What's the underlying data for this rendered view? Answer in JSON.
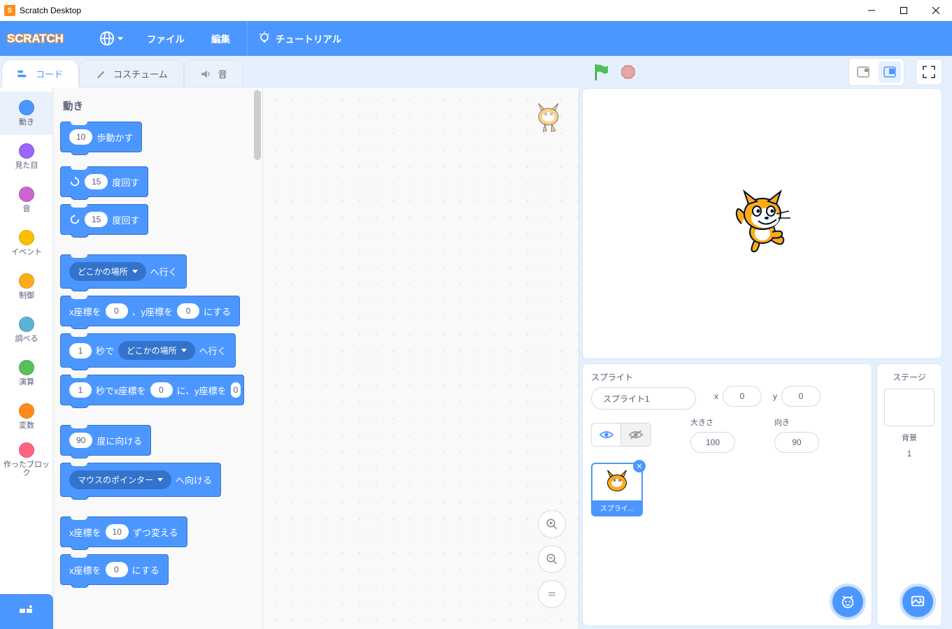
{
  "window": {
    "title": "Scratch Desktop"
  },
  "menu": {
    "file": "ファイル",
    "edit": "編集",
    "tutorials": "チュートリアル"
  },
  "tabs": {
    "code": "コード",
    "costumes": "コスチューム",
    "sounds": "音"
  },
  "categories": [
    {
      "label": "動き",
      "color": "#4C97FF"
    },
    {
      "label": "見た目",
      "color": "#9966FF"
    },
    {
      "label": "音",
      "color": "#CF63CF"
    },
    {
      "label": "イベント",
      "color": "#FFBF00"
    },
    {
      "label": "制御",
      "color": "#FFAB19"
    },
    {
      "label": "調べる",
      "color": "#5CB1D6"
    },
    {
      "label": "演算",
      "color": "#59C059"
    },
    {
      "label": "変数",
      "color": "#FF8C1A"
    },
    {
      "label": "作ったブロック",
      "color": "#FF6680"
    }
  ],
  "blocks_heading": "動き",
  "blocks": {
    "move_steps_val": "10",
    "move_steps_suf": "歩動かす",
    "turn_cw_val": "15",
    "turn_cw_suf": "度回す",
    "turn_ccw_val": "15",
    "turn_ccw_suf": "度回す",
    "goto_dd": "どこかの場所",
    "goto_suf": "へ行く",
    "gotoxy_pre": "x座標を",
    "gotoxy_x": "0",
    "gotoxy_mid": "、y座標を",
    "gotoxy_y": "0",
    "gotoxy_suf": "にする",
    "glide_sec": "1",
    "glide_mid": "秒で",
    "glide_dd": "どこかの場所",
    "glide_suf": "へ行く",
    "glidexy_sec": "1",
    "glidexy_mid": "秒でx座標を",
    "glidexy_x": "0",
    "glidexy_mid2": "に、y座標を",
    "glidexy_y": "0",
    "point_dir_val": "90",
    "point_dir_suf": "度に向ける",
    "point_to_dd": "マウスのポインター",
    "point_to_suf": "へ向ける",
    "changex_pre": "x座標を",
    "changex_val": "10",
    "changex_suf": "ずつ変える",
    "setx_pre": "x座標を",
    "setx_val": "0",
    "setx_suf": "にする"
  },
  "sprite_panel": {
    "title": "スプライト",
    "name": "スプライト1",
    "x_label": "x",
    "x": "0",
    "y_label": "y",
    "y": "0",
    "size_label": "大きさ",
    "size": "100",
    "dir_label": "向き",
    "dir": "90",
    "thumb_label": "スプライ..."
  },
  "stage_panel": {
    "title": "ステージ",
    "backdrop_label": "背景",
    "backdrop_count": "1"
  }
}
